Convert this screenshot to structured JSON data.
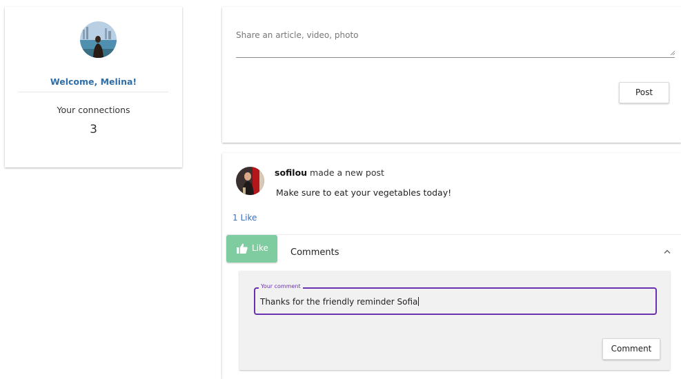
{
  "profile": {
    "welcome": "Welcome, Melina!",
    "connections_label": "Your connections",
    "connections_count": "3"
  },
  "share": {
    "placeholder": "Share an article, video, photo",
    "post_label": "Post"
  },
  "post": {
    "author": "sofilou",
    "action": " made a new post",
    "body": "Make sure to eat your vegetables today!",
    "likes": "1 Like",
    "like_button": "Like",
    "comments_title": "Comments",
    "comment_field_label": "Your comment",
    "comment_value": "Thanks for the friendly reminder Sofia",
    "comment_button": "Comment"
  },
  "colors": {
    "welcome": "#2f6ea8",
    "like_button": "#7fcca0",
    "focus": "#6a2fb0",
    "link": "#3d6fb6"
  },
  "icons": [
    "thumbs-up-icon",
    "chevron-up-icon",
    "resize-grip-icon"
  ]
}
